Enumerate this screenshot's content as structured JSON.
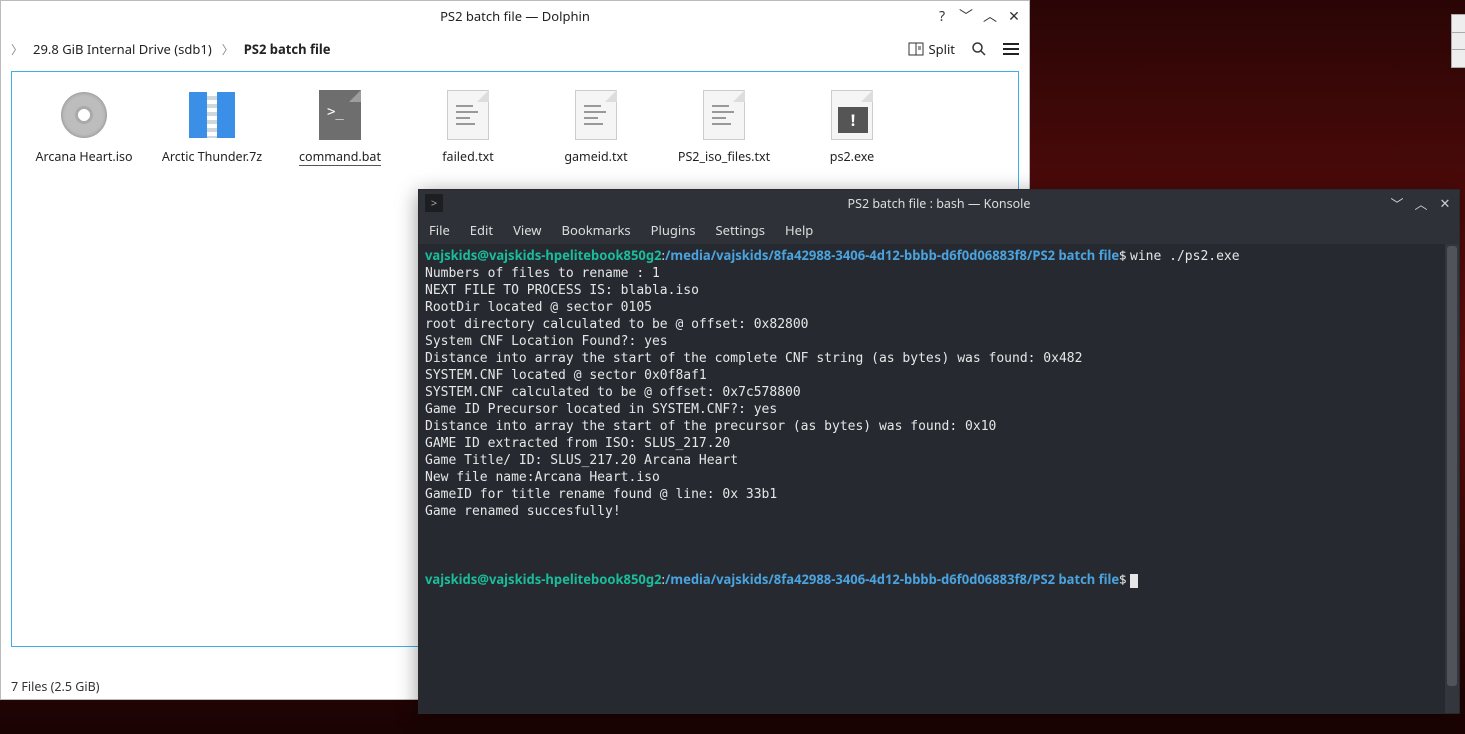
{
  "dolphin": {
    "title": "PS2 batch file — Dolphin",
    "breadcrumb": {
      "drive": "29.8 GiB Internal Drive (sdb1)",
      "current": "PS2 batch file"
    },
    "toolbar": {
      "split": "Split"
    },
    "files": [
      {
        "name": "Arcana Heart.iso",
        "icon": "iso"
      },
      {
        "name": "Arctic Thunder.7z",
        "icon": "archive"
      },
      {
        "name": "command.bat",
        "icon": "bat",
        "selected": true
      },
      {
        "name": "failed.txt",
        "icon": "txt"
      },
      {
        "name": "gameid.txt",
        "icon": "txt"
      },
      {
        "name": "PS2_iso_files.txt",
        "icon": "txt"
      },
      {
        "name": "ps2.exe",
        "icon": "exe"
      }
    ],
    "status": "7 Files (2.5 GiB)"
  },
  "konsole": {
    "title": "PS2 batch file : bash — Konsole",
    "menu": [
      "File",
      "Edit",
      "View",
      "Bookmarks",
      "Plugins",
      "Settings",
      "Help"
    ],
    "prompt": {
      "user": "vajskids@vajskids-hpelitebook850g2",
      "path": "/media/vajskids/8fa42988-3406-4d12-bbbb-d6f0d06883f8/PS2 batch file",
      "command": "wine ./ps2.exe"
    },
    "output": [
      "Numbers of files to rename : 1",
      "NEXT FILE TO PROCESS IS: blabla.iso",
      "RootDir located @ sector 0105",
      "root directory calculated to be @ offset: 0x82800",
      "System CNF Location Found?: yes",
      "Distance into array the start of the complete CNF string (as bytes) was found: 0x482",
      "SYSTEM.CNF located @ sector 0x0f8af1",
      "SYSTEM.CNF calculated to be @ offset: 0x7c578800",
      "Game ID Precursor located in SYSTEM.CNF?: yes",
      "Distance into array the start of the precursor (as bytes) was found: 0x10",
      "GAME ID extracted from ISO: SLUS_217.20",
      "Game Title/ ID: SLUS_217.20 Arcana Heart",
      "New file name:Arcana Heart.iso",
      "GameID for title rename found @ line: 0x 33b1",
      "Game renamed succesfully!"
    ]
  }
}
